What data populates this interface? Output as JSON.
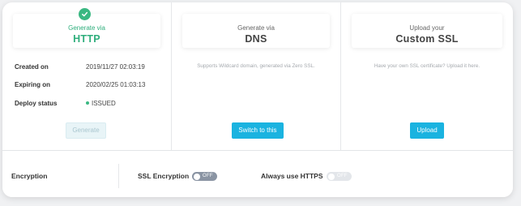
{
  "methods": {
    "http": {
      "small": "Generate via",
      "big": "HTTP"
    },
    "dns": {
      "small": "Generate via",
      "big": "DNS",
      "description": "Supports Wildcard domain, generated via Zero SSL.",
      "button": "Switch to this"
    },
    "custom": {
      "small": "Upload your",
      "big": "Custom SSL",
      "description": "Have your own SSL certificate? Upload it here.",
      "button": "Upload"
    }
  },
  "details": {
    "created_label": "Created on",
    "created_value": "2019/11/27 02:03:19",
    "expiring_label": "Expiring on",
    "expiring_value": "2020/02/25 01:03:13",
    "deploy_label": "Deploy status",
    "deploy_value": "ISSUED"
  },
  "generate_button": "Generate",
  "encryption": {
    "label": "Encryption",
    "ssl_label": "SSL Encryption",
    "ssl_state": "OFF",
    "https_label": "Always use HTTPS",
    "https_state": "OFF"
  },
  "colors": {
    "accent_green": "#2fae7c",
    "primary_button": "#1ab3e0",
    "toggle_off": "#8a94a3"
  },
  "icons": {
    "selected": "check-circle-icon"
  }
}
